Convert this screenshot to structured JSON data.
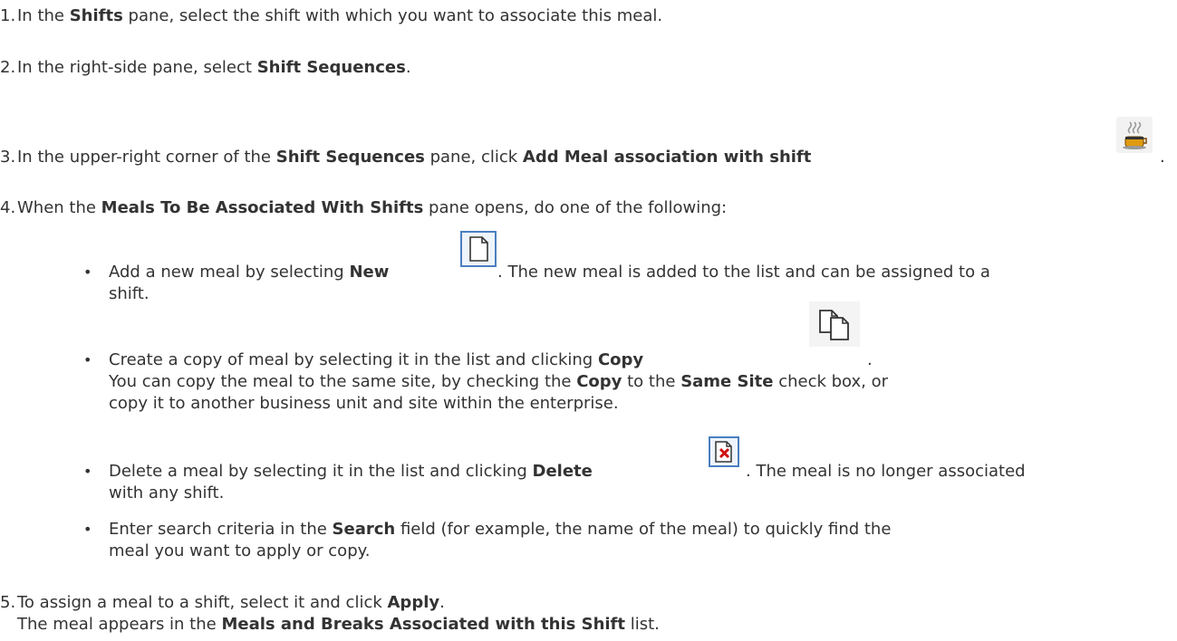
{
  "steps": {
    "s1": {
      "num": "1.",
      "pre": "In the ",
      "b1": "Shifts",
      "post": " pane, select the shift with which you want to associate this meal."
    },
    "s2": {
      "num": "2.",
      "pre": "In the right-side pane, select ",
      "b1": "Shift Sequences",
      "post": "."
    },
    "s3": {
      "num": "3.",
      "pre": "In the upper-right corner of the ",
      "b1": "Shift Sequences",
      "mid": " pane, click ",
      "b2": "Add Meal association with shift",
      "post": "."
    },
    "s4": {
      "num": "4.",
      "pre": "When the ",
      "b1": "Meals To Be Associated With Shifts",
      "post": " pane opens, do one of the following:"
    },
    "s5": {
      "num": "5.",
      "pre": "To assign a meal to a shift, select it and click ",
      "b1": "Apply",
      "post": ".",
      "l2_pre": "The meal appears in the ",
      "l2_b": "Meals and Breaks Associated with this Shift",
      "l2_post": " list."
    }
  },
  "bullets": {
    "new": {
      "pre": "Add a new meal by selecting ",
      "b1": "New",
      "post": ". The new meal is added to the list and can be assigned to a",
      "l2": "shift."
    },
    "copy": {
      "pre": "Create a copy of meal by selecting it in the list and clicking ",
      "b1": "Copy",
      "post": ".",
      "l2_pre": "You can copy the meal to the same site, by checking the ",
      "l2_b1": "Copy",
      "l2_mid": " to the ",
      "l2_b2": "Same Site",
      "l2_post": " check box, or",
      "l3": "copy it to another business unit and site within the enterprise."
    },
    "delete": {
      "pre": "Delete a meal by selecting it in the list and clicking ",
      "b1": "Delete",
      "post": ". The meal is no longer associated",
      "l2": "with any shift."
    },
    "search": {
      "pre": "Enter search criteria in the ",
      "b1": "Search",
      "post": " field (for example, the name of the meal) to quickly find the",
      "l2": "meal you want to apply or copy."
    }
  },
  "bullet_glyph": "•",
  "icons": [
    "add-meal-association-icon",
    "new-document-icon",
    "copy-documents-icon",
    "delete-document-icon"
  ],
  "colors": {
    "text": "#333333",
    "icon_border": "#4a7fc0",
    "delete_red": "#d01010",
    "cup_orange": "#e09a10"
  }
}
